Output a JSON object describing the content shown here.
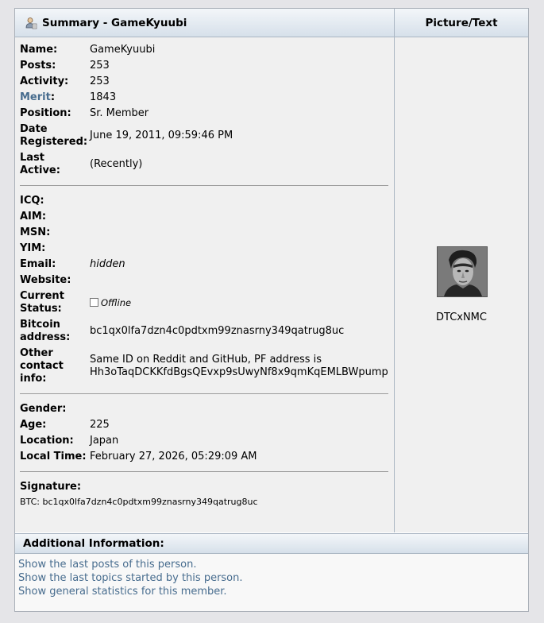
{
  "header": {
    "summary_title": "Summary - GameKyuubi",
    "picture_title": "Picture/Text"
  },
  "profile": {
    "name_label": "Name:",
    "name": "GameKyuubi",
    "posts_label": "Posts:",
    "posts": "253",
    "activity_label": "Activity:",
    "activity": "253",
    "merit_label": "Merit",
    "merit_colon": ":",
    "merit": "1843",
    "position_label": "Position:",
    "position": "Sr. Member",
    "date_label_1": "Date",
    "date_label_2": "Registered:",
    "date_registered": "June 19, 2011, 09:59:46 PM",
    "last_label_1": "Last",
    "last_label_2": "Active:",
    "last_active": "(Recently)"
  },
  "contact": {
    "icq_label": "ICQ:",
    "aim_label": "AIM:",
    "msn_label": "MSN:",
    "yim_label": "YIM:",
    "email_label": "Email:",
    "email": "hidden",
    "website_label": "Website:",
    "status_label_1": "Current",
    "status_label_2": "Status:",
    "status": "Offline",
    "bitcoin_label_1": "Bitcoin",
    "bitcoin_label_2": "address:",
    "bitcoin": "bc1qx0lfa7dzn4c0pdtxm99znasrny349qatrug8uc",
    "other_label_1": "Other",
    "other_label_2": "contact",
    "other_label_3": "info:",
    "other_line_1": "Same ID on Reddit and GitHub, PF address is",
    "other_line_2": "Hh3oTaqDCKKfdBgsQEvxp9sUwyNf8x9qmKqEMLBWpump"
  },
  "personal": {
    "gender_label": "Gender:",
    "age_label": "Age:",
    "age": "225",
    "location_label": "Location:",
    "location": "Japan",
    "time_label": "Local Time:",
    "local_time": "February 27, 2026, 05:29:09 AM"
  },
  "signature": {
    "label": "Signature:",
    "text": "BTC: bc1qx0lfa7dzn4c0pdtxm99znasrny349qatrug8uc"
  },
  "picture": {
    "avatar_icon": "user-avatar-photo",
    "personal_text": "DTCxNMC"
  },
  "additional": {
    "title": "Additional Information:",
    "links": [
      "Show the last posts of this person.",
      "Show the last topics started by this person.",
      "Show general statistics for this member."
    ]
  },
  "colors": {
    "link": "#476c8e",
    "header_gradient_top": "#f3f6f9",
    "header_gradient_bottom": "#d6e0ea",
    "panel_bg": "#f0f0f0"
  }
}
